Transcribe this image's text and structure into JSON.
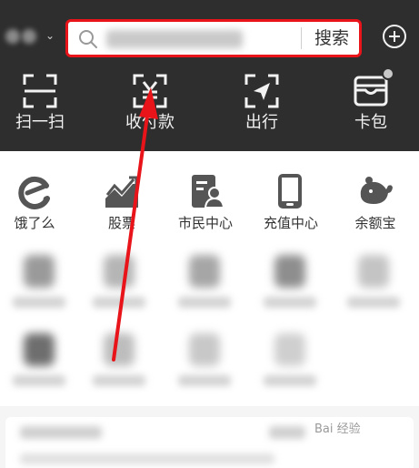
{
  "header": {
    "search": {
      "button_label": "搜索"
    },
    "shortcuts": [
      {
        "label": "扫一扫",
        "icon": "scan-icon"
      },
      {
        "label": "收付款",
        "icon": "payment-code-icon"
      },
      {
        "label": "出行",
        "icon": "travel-icon"
      },
      {
        "label": "卡包",
        "icon": "card-wallet-icon"
      }
    ]
  },
  "apps": [
    {
      "label": "饿了么",
      "icon": "eleme-icon"
    },
    {
      "label": "股票",
      "icon": "stock-chart-icon"
    },
    {
      "label": "市民中心",
      "icon": "citizen-center-icon"
    },
    {
      "label": "充值中心",
      "icon": "phone-topup-icon"
    },
    {
      "label": "余额宝",
      "icon": "yuebao-icon"
    }
  ],
  "watermark": "Bai 经验",
  "colors": {
    "header_bg": "#2e2e2e",
    "highlight_red": "#e8141a",
    "app_icon_gray": "#555555"
  }
}
